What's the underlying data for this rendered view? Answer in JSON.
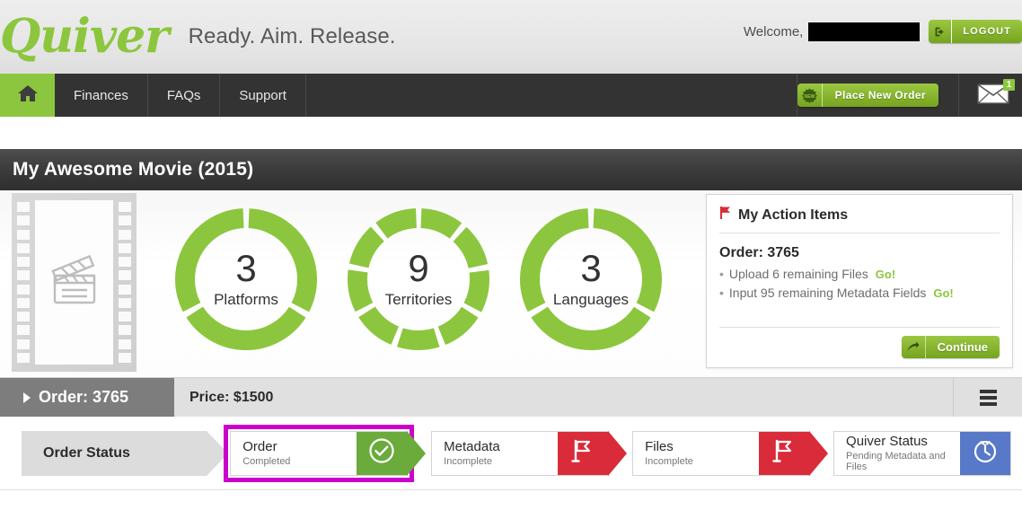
{
  "header": {
    "logo_text": "Quiver",
    "tagline": "Ready. Aim. Release.",
    "welcome_label": "Welcome,",
    "username_redacted": "",
    "logout_label": "LOGOUT",
    "logout_icon": "logout-arrow-icon"
  },
  "nav": {
    "home_icon": "home-icon",
    "items": [
      {
        "label": "Finances"
      },
      {
        "label": "FAQs"
      },
      {
        "label": "Support"
      }
    ],
    "place_order_label": "Place New Order",
    "place_order_icon": "starburst-badge-icon",
    "mail_icon": "envelope-icon",
    "mail_badge_count": "1"
  },
  "page": {
    "title": "My Awesome Movie (2015)"
  },
  "thumbnail": {
    "icon": "clapperboard-icon",
    "frame": "film-strip-placeholder"
  },
  "chart_data": [
    {
      "type": "pie",
      "title": "Platforms",
      "value": 3,
      "segments": 3,
      "label": "Platforms",
      "number": "3",
      "color": "#8cc63e"
    },
    {
      "type": "pie",
      "title": "Territories",
      "value": 9,
      "segments": 9,
      "label": "Territories",
      "number": "9",
      "color": "#8cc63e"
    },
    {
      "type": "pie",
      "title": "Languages",
      "value": 3,
      "segments": 3,
      "label": "Languages",
      "number": "3",
      "color": "#8cc63e"
    }
  ],
  "action_panel": {
    "flag_icon": "red-flag-icon",
    "title": "My Action Items",
    "order_heading": "Order: 3765",
    "items": [
      {
        "text": "Upload 6 remaining Files",
        "action": "Go!"
      },
      {
        "text": "Input 95 remaining Metadata Fields",
        "action": "Go!"
      }
    ],
    "continue_label": "Continue",
    "continue_icon": "arrow-forward-icon"
  },
  "order_bar": {
    "order_label": "Order: 3765",
    "caret_icon": "caret-right-icon",
    "price_label": "Price: $1500",
    "menu_icon": "hamburger-menu-icon"
  },
  "status_track": {
    "section_label": "Order Status",
    "steps": [
      {
        "title": "Order",
        "subtitle": "Completed",
        "icon": "check-circle-icon",
        "badge_color": "#6aab3c",
        "highlighted": true
      },
      {
        "title": "Metadata",
        "subtitle": "Incomplete",
        "icon": "flag-icon",
        "badge_color": "#d92b39",
        "highlighted": false
      },
      {
        "title": "Files",
        "subtitle": "Incomplete",
        "icon": "flag-icon",
        "badge_color": "#d92b39",
        "highlighted": false
      },
      {
        "title": "Quiver Status",
        "subtitle": "Pending Metadata and Files",
        "icon": "clock-icon",
        "badge_color": "#5878c8",
        "highlighted": false
      }
    ]
  },
  "colors": {
    "brand_green": "#8cc63e",
    "nav_dark": "#333333",
    "status_red": "#d92b39",
    "status_blue": "#5878c8",
    "highlight_magenta": "#cc00cc"
  }
}
